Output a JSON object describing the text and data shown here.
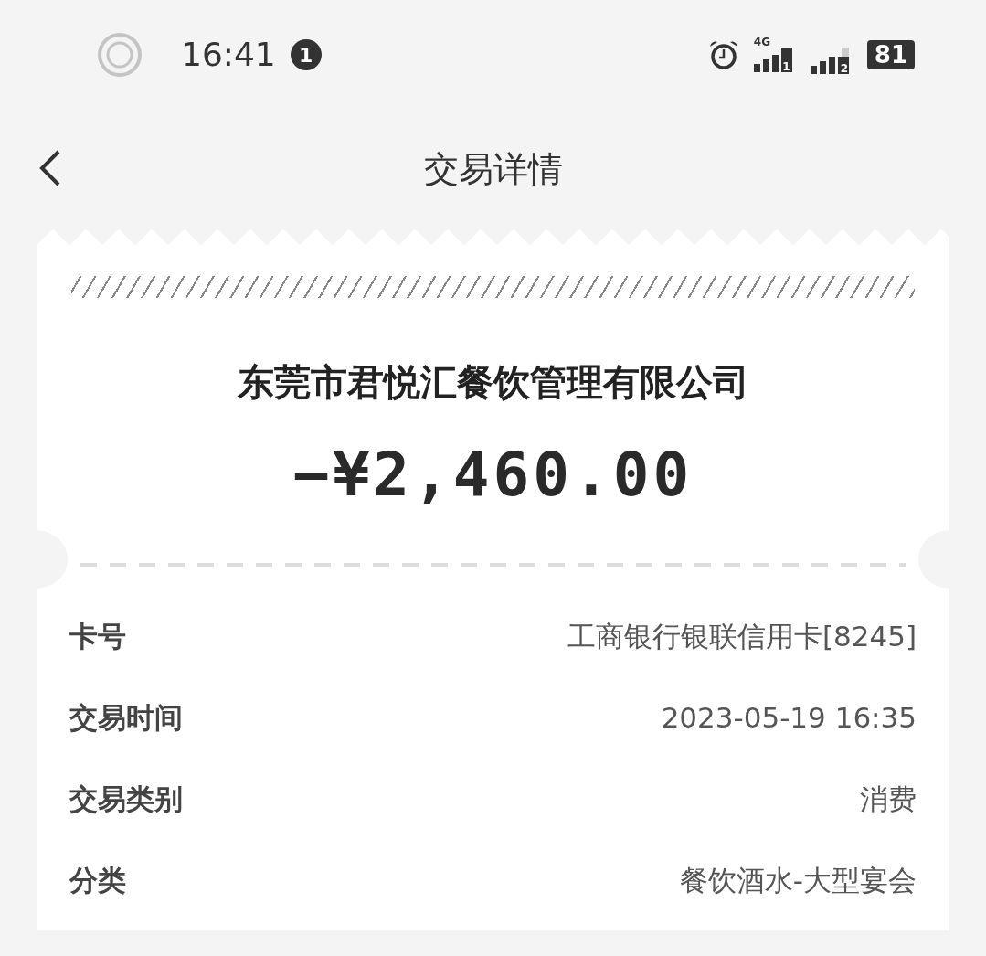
{
  "status_bar": {
    "time": "16:41",
    "notification_count": "1",
    "network": "4G",
    "sims": [
      "1",
      "2"
    ],
    "battery": "81"
  },
  "header": {
    "title": "交易详情"
  },
  "receipt": {
    "merchant": "东莞市君悦汇餐饮管理有限公司",
    "amount": "−¥2,460.00",
    "rows": [
      {
        "label": "卡号",
        "value": "工商银行银联信用卡[8245]"
      },
      {
        "label": "交易时间",
        "value": "2023-05-19 16:35"
      },
      {
        "label": "交易类别",
        "value": "消费"
      },
      {
        "label": "分类",
        "value": "餐饮酒水-大型宴会"
      }
    ]
  }
}
